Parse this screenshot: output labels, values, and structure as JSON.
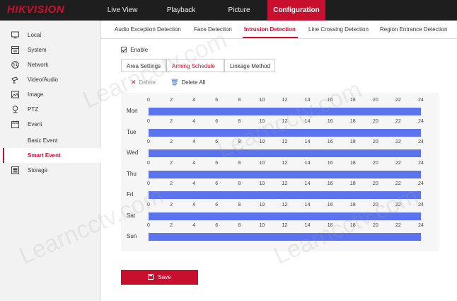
{
  "brand": {
    "logo": "HIKVISION",
    "accent": "#c8102e"
  },
  "nav": [
    {
      "label": "Live View",
      "active": false
    },
    {
      "label": "Playback",
      "active": false
    },
    {
      "label": "Picture",
      "active": false
    },
    {
      "label": "Configuration",
      "active": true
    }
  ],
  "sidebar": {
    "items": [
      {
        "label": "Local",
        "icon": "monitor-icon"
      },
      {
        "label": "System",
        "icon": "system-icon"
      },
      {
        "label": "Network",
        "icon": "globe-icon"
      },
      {
        "label": "Video/Audio",
        "icon": "camera-icon"
      },
      {
        "label": "Image",
        "icon": "image-icon"
      },
      {
        "label": "PTZ",
        "icon": "ptz-icon"
      },
      {
        "label": "Event",
        "icon": "calendar-icon"
      },
      {
        "label": "Basic Event",
        "icon": ""
      },
      {
        "label": "Smart Event",
        "icon": "",
        "active": true
      },
      {
        "label": "Storage",
        "icon": "storage-icon"
      }
    ]
  },
  "subtabs": [
    {
      "label": "Audio Exception Detection"
    },
    {
      "label": "Face Detection"
    },
    {
      "label": "Intrusion Detection",
      "active": true
    },
    {
      "label": "Line Crossing Detection"
    },
    {
      "label": "Region Entrance Detection"
    }
  ],
  "enable": {
    "label": "Enable",
    "checked": true
  },
  "steps": [
    {
      "label": "Area Settings"
    },
    {
      "label": "Arming Schedule",
      "active": true
    },
    {
      "label": "Linkage Method"
    }
  ],
  "toolbar": {
    "delete_label": "Delete",
    "delete_all_label": "Delete All"
  },
  "schedule": {
    "ticks": [
      "0",
      "2",
      "4",
      "6",
      "8",
      "10",
      "12",
      "14",
      "16",
      "18",
      "20",
      "22",
      "24"
    ],
    "days": [
      "Mon",
      "Tue",
      "Wed",
      "Thu",
      "Fri",
      "Sat",
      "Sun"
    ],
    "armed_from_hour": 0,
    "armed_to_hour": 24,
    "bar_color": "#5b73ed"
  },
  "save_label": "Save",
  "watermark": "Learncctv.com"
}
